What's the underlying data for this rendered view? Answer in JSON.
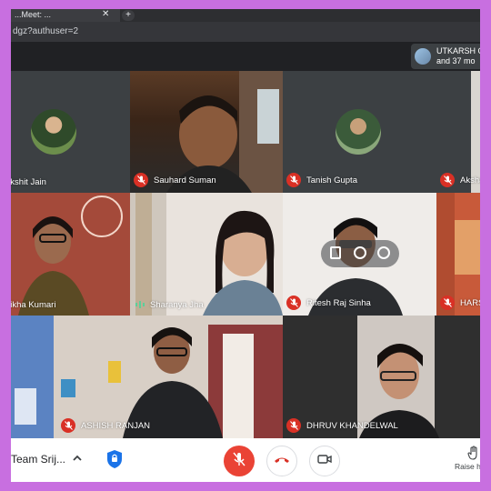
{
  "browser": {
    "tab_title": "...Meet: ...",
    "url": "dgz?authuser=2"
  },
  "header": {
    "participant_name": "UTKARSH C",
    "participant_more": "and 37 mo"
  },
  "tiles": [
    {
      "name": "akshit Jain",
      "muted": false
    },
    {
      "name": "Sauhard Suman",
      "muted": true
    },
    {
      "name": "Tanish Gupta",
      "muted": true
    },
    {
      "name": "Aksha",
      "muted": true
    },
    {
      "name": "hikha Kumari",
      "muted": false
    },
    {
      "name": "Sharanya Jha",
      "muted": false,
      "speaking": true
    },
    {
      "name": "Ritesh Raj Sinha",
      "muted": true
    },
    {
      "name": "HARS",
      "muted": true
    },
    {
      "name": "ASHISH RANJAN",
      "muted": true
    },
    {
      "name": "DHRUV KHANDELWAL",
      "muted": true
    }
  ],
  "bottom_bar": {
    "meeting_name": "Team Srij...",
    "raise_hand_label": "Raise h"
  },
  "colors": {
    "mute_red": "#d93025",
    "page_border": "#c86fe0",
    "meet_dark": "#202124"
  },
  "icons": {
    "mic_off": "mic-off-icon",
    "end_call": "end-call-icon",
    "camera": "camera-icon",
    "shield": "shield-icon",
    "raise_hand": "raise-hand-icon"
  }
}
